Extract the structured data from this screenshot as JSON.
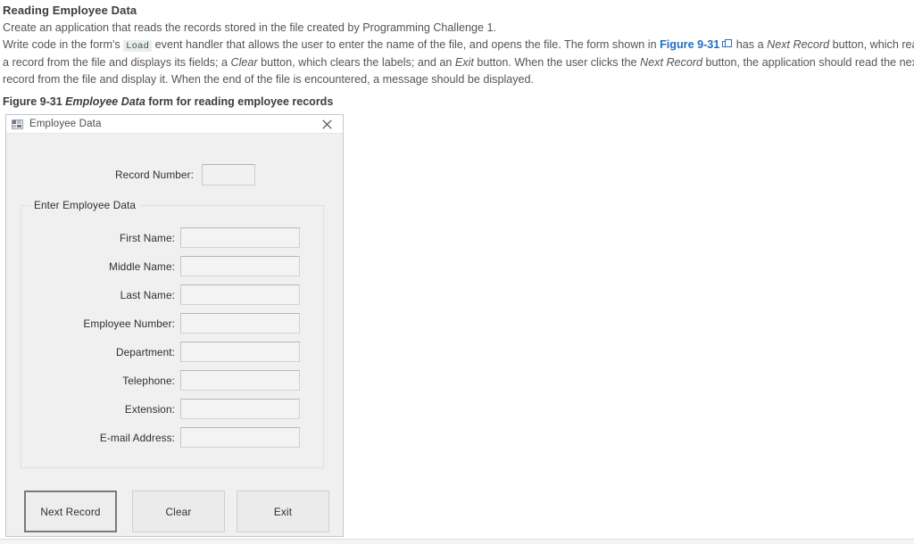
{
  "document": {
    "title": "Reading Employee Data",
    "paragraph_lines": [
      {
        "segments": [
          {
            "type": "text",
            "text": "Create an application that reads the records stored in the file created by Programming Challenge 1."
          }
        ]
      },
      {
        "segments": [
          {
            "type": "text",
            "text": "Write code in the form's "
          },
          {
            "type": "code",
            "text": "Load"
          },
          {
            "type": "text",
            "text": " event handler that allows the user to enter the name of the file, and opens the file. The form shown in "
          },
          {
            "type": "link",
            "text": "Figure 9-31"
          },
          {
            "type": "icon",
            "text": "popout-icon"
          },
          {
            "type": "text",
            "text": " has a "
          },
          {
            "type": "italic",
            "text": "Next Record"
          },
          {
            "type": "text",
            "text": " button, which reads"
          }
        ]
      },
      {
        "segments": [
          {
            "type": "text",
            "text": "a record from the file and displays its fields; a "
          },
          {
            "type": "italic",
            "text": "Clear"
          },
          {
            "type": "text",
            "text": " button, which clears the labels; and an "
          },
          {
            "type": "italic",
            "text": "Exit"
          },
          {
            "type": "text",
            "text": " button. When the user clicks the "
          },
          {
            "type": "italic",
            "text": "Next Record"
          },
          {
            "type": "text",
            "text": " button, the application should read the next"
          }
        ]
      },
      {
        "segments": [
          {
            "type": "text",
            "text": "record from the file and display it. When the end of the file is encountered, a message should be displayed."
          }
        ]
      }
    ],
    "figure_caption": {
      "prefix": "Figure 9-31 ",
      "italic": "Employee Data",
      "suffix": " form for reading employee records"
    }
  },
  "form": {
    "titlebar": {
      "icon": "app-window-icon",
      "title": "Employee Data",
      "close_label": "✕"
    },
    "record_number": {
      "label": "Record Number:",
      "value": "",
      "placeholder": ""
    },
    "groupbox": {
      "legend": "Enter Employee Data",
      "fields": [
        {
          "label": "First Name:",
          "value": "",
          "name": "first-name"
        },
        {
          "label": "Middle Name:",
          "value": "",
          "name": "middle-name"
        },
        {
          "label": "Last Name:",
          "value": "",
          "name": "last-name"
        },
        {
          "label": "Employee Number:",
          "value": "",
          "name": "employee-number"
        },
        {
          "label": "Department:",
          "value": "",
          "name": "department"
        },
        {
          "label": "Telephone:",
          "value": "",
          "name": "telephone"
        },
        {
          "label": "Extension:",
          "value": "",
          "name": "extension"
        },
        {
          "label": "E-mail Address:",
          "value": "",
          "name": "email-address"
        }
      ]
    },
    "buttons": [
      {
        "label": "Next Record",
        "name": "next-record",
        "default": true
      },
      {
        "label": "Clear",
        "name": "clear",
        "default": false
      },
      {
        "label": "Exit",
        "name": "exit",
        "default": false
      }
    ]
  },
  "colors": {
    "link": "#1f6fc4",
    "form_background": "#f0f0f0",
    "code_background": "#e8eeea",
    "body_text": "#555555",
    "heading_text": "#3c3c3c"
  }
}
